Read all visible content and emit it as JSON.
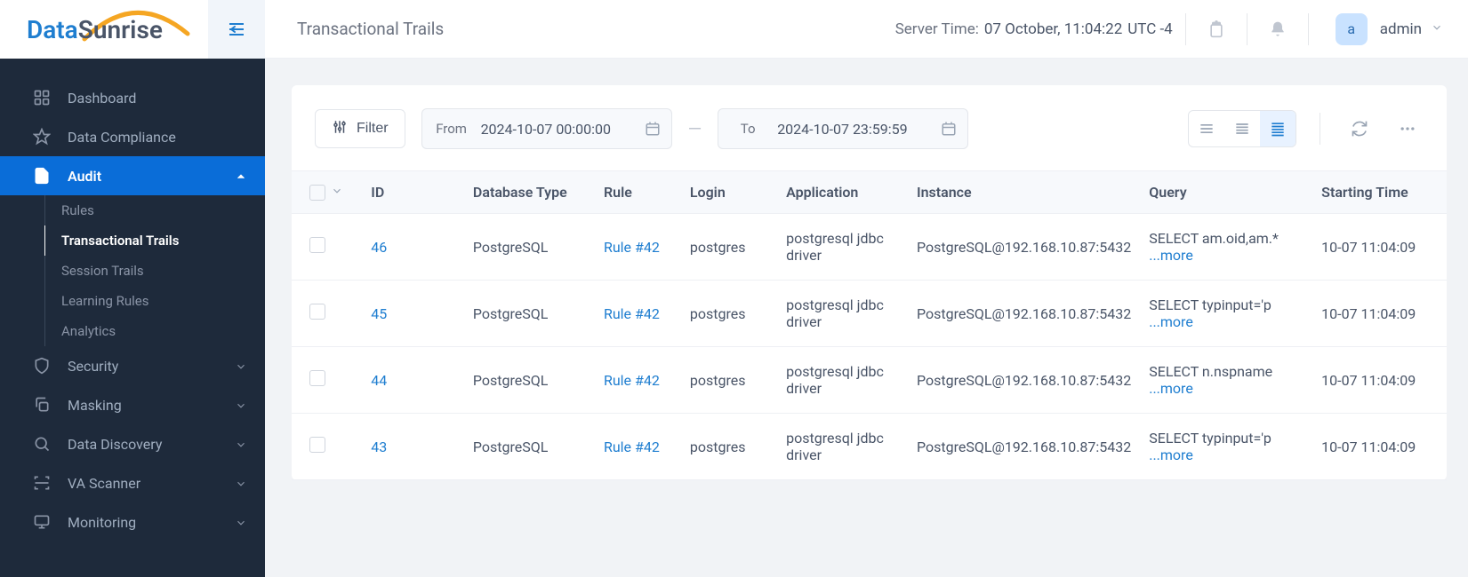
{
  "brand": {
    "part1": "Data",
    "part2": "Sunrise"
  },
  "header": {
    "title": "Transactional Trails",
    "server_time_label": "Server Time:",
    "server_time_value": "07 October, 11:04:22",
    "server_tz": "UTC -4",
    "user_initial": "a",
    "user_name": "admin"
  },
  "sidebar": {
    "items": [
      {
        "label": "Dashboard"
      },
      {
        "label": "Data Compliance"
      },
      {
        "label": "Audit"
      },
      {
        "label": "Security"
      },
      {
        "label": "Masking"
      },
      {
        "label": "Data Discovery"
      },
      {
        "label": "VA Scanner"
      },
      {
        "label": "Monitoring"
      }
    ],
    "audit_sub": [
      {
        "label": "Rules"
      },
      {
        "label": "Transactional Trails"
      },
      {
        "label": "Session Trails"
      },
      {
        "label": "Learning Rules"
      },
      {
        "label": "Analytics"
      }
    ]
  },
  "toolbar": {
    "filter_label": "Filter",
    "from_label": "From",
    "from_value": "2024-10-07 00:00:00",
    "to_label": "To",
    "to_value": "2024-10-07 23:59:59"
  },
  "columns": {
    "id": "ID",
    "db": "Database Type",
    "rule": "Rule",
    "login": "Login",
    "app": "Application",
    "instance": "Instance",
    "query": "Query",
    "time": "Starting Time"
  },
  "more_label": "...more",
  "rows": [
    {
      "id": "46",
      "db": "PostgreSQL",
      "rule": "Rule #42",
      "login": "postgres",
      "app": "postgresql jdbc driver",
      "instance": "PostgreSQL@192.168.10.87:5432",
      "query": "SELECT am.oid,am.*",
      "time": "10-07 11:04:09"
    },
    {
      "id": "45",
      "db": "PostgreSQL",
      "rule": "Rule #42",
      "login": "postgres",
      "app": "postgresql jdbc driver",
      "instance": "PostgreSQL@192.168.10.87:5432",
      "query": "SELECT typinput='p",
      "time": "10-07 11:04:09"
    },
    {
      "id": "44",
      "db": "PostgreSQL",
      "rule": "Rule #42",
      "login": "postgres",
      "app": "postgresql jdbc driver",
      "instance": "PostgreSQL@192.168.10.87:5432",
      "query": "SELECT n.nspname",
      "time": "10-07 11:04:09"
    },
    {
      "id": "43",
      "db": "PostgreSQL",
      "rule": "Rule #42",
      "login": "postgres",
      "app": "postgresql jdbc driver",
      "instance": "PostgreSQL@192.168.10.87:5432",
      "query": "SELECT typinput='p",
      "time": "10-07 11:04:09"
    }
  ]
}
